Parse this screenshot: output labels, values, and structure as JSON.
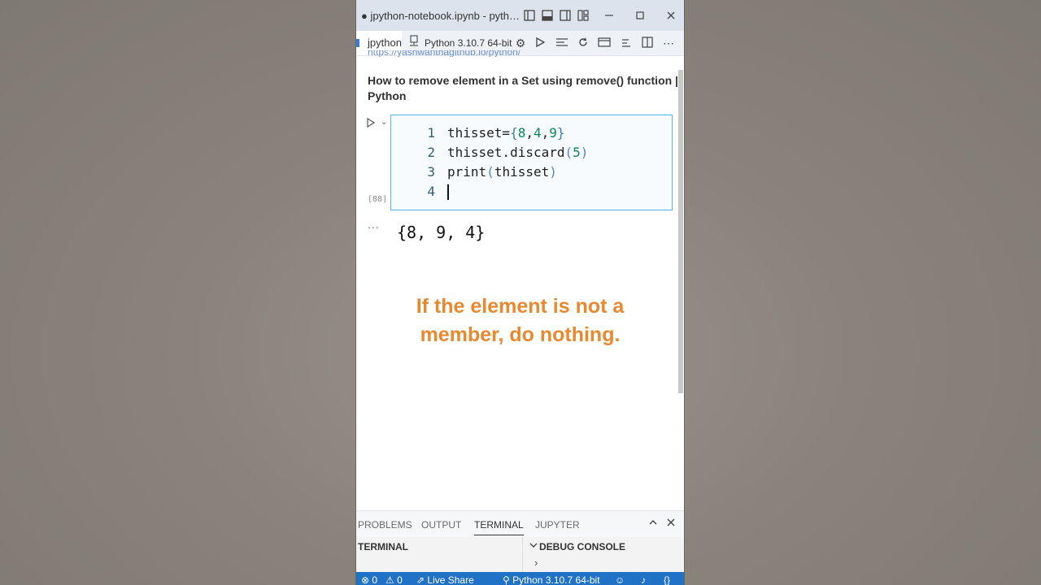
{
  "window": {
    "title": "● jpython-notebook.ipynb - python..."
  },
  "toolbar": {
    "tab_label": "jpython",
    "kernel_label": "Python 3.10.7 64-bit"
  },
  "notebook": {
    "link_fragment": "https://yashwanthagithub.io/python/",
    "heading": "How to remove element in a Set using remove() function | Python",
    "cell": {
      "execution_count": "[88]",
      "lines": [
        {
          "num": "1",
          "parts": [
            {
              "t": "thisset=",
              "c": "plain"
            },
            {
              "t": "{",
              "c": "brace"
            },
            {
              "t": "8",
              "c": "num"
            },
            {
              "t": ",",
              "c": "plain"
            },
            {
              "t": "4",
              "c": "num"
            },
            {
              "t": ",",
              "c": "plain"
            },
            {
              "t": "9",
              "c": "num"
            },
            {
              "t": "}",
              "c": "brace"
            }
          ]
        },
        {
          "num": "2",
          "parts": [
            {
              "t": "thisset.discard",
              "c": "plain"
            },
            {
              "t": "(",
              "c": "paren"
            },
            {
              "t": "5",
              "c": "num"
            },
            {
              "t": ")",
              "c": "paren"
            }
          ]
        },
        {
          "num": "3",
          "parts": [
            {
              "t": "print",
              "c": "plain"
            },
            {
              "t": "(",
              "c": "paren"
            },
            {
              "t": "thisset",
              "c": "plain"
            },
            {
              "t": ")",
              "c": "paren"
            }
          ]
        },
        {
          "num": "4",
          "parts": []
        }
      ]
    },
    "output_dots": "...",
    "output": "{8, 9, 4}"
  },
  "caption": {
    "line1": "If the element is not a",
    "line2": "member, do nothing."
  },
  "panel": {
    "tabs": [
      "PROBLEMS",
      "OUTPUT",
      "TERMINAL",
      "JUPYTER"
    ],
    "active_tab": "TERMINAL",
    "left_title": "TERMINAL",
    "right_title": "DEBUG CONSOLE",
    "prompt": "›"
  },
  "statusbar": {
    "errors": "⊗ 0",
    "warnings": "⚠ 0",
    "live_share": "Live Share",
    "kernel": "Python 3.10.7 64-bit"
  },
  "colors": {
    "accent": "#1f72c5",
    "caption": "#e8892f",
    "cell_border": "#5ab0e8"
  }
}
